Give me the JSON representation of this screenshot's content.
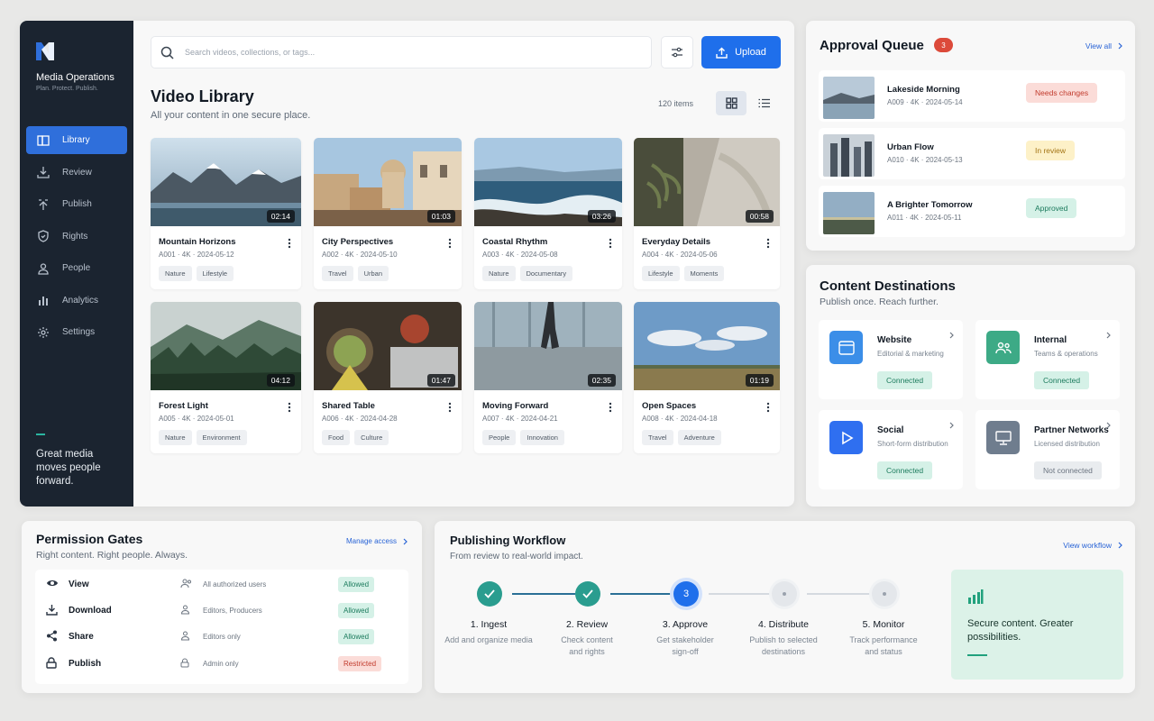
{
  "sidebar": {
    "brand": "Media Operations",
    "tagline": "Plan. Protect. Publish.",
    "nav": [
      {
        "label": "Library",
        "icon": "library-icon"
      },
      {
        "label": "Review",
        "icon": "download-icon"
      },
      {
        "label": "Publish",
        "icon": "upload-icon"
      },
      {
        "label": "Rights",
        "icon": "shield-icon"
      },
      {
        "label": "People",
        "icon": "person-icon"
      },
      {
        "label": "Analytics",
        "icon": "bar-chart-icon"
      },
      {
        "label": "Settings",
        "icon": "gear-icon"
      }
    ],
    "quote": "Great media moves people forward."
  },
  "search": {
    "placeholder": "Search videos, collections, or tags..."
  },
  "upload_label": "Upload",
  "library": {
    "title": "Video Library",
    "subtitle": "All your content in one secure place.",
    "count": "120 items",
    "videos": [
      {
        "title": "Mountain Horizons",
        "meta": "A001 · 4K · 2024-05-12",
        "duration": "02:14",
        "tags": [
          "Nature",
          "Lifestyle"
        ]
      },
      {
        "title": "City Perspectives",
        "meta": "A002 · 4K · 2024-05-10",
        "duration": "01:03",
        "tags": [
          "Travel",
          "Urban"
        ]
      },
      {
        "title": "Coastal Rhythm",
        "meta": "A003 · 4K · 2024-05-08",
        "duration": "03:26",
        "tags": [
          "Nature",
          "Documentary"
        ]
      },
      {
        "title": "Everyday Details",
        "meta": "A004 · 4K · 2024-05-06",
        "duration": "00:58",
        "tags": [
          "Lifestyle",
          "Moments"
        ]
      },
      {
        "title": "Forest Light",
        "meta": "A005 · 4K · 2024-05-01",
        "duration": "04:12",
        "tags": [
          "Nature",
          "Environment"
        ]
      },
      {
        "title": "Shared Table",
        "meta": "A006 · 4K · 2024-04-28",
        "duration": "01:47",
        "tags": [
          "Food",
          "Culture"
        ]
      },
      {
        "title": "Moving Forward",
        "meta": "A007 · 4K · 2024-04-21",
        "duration": "02:35",
        "tags": [
          "People",
          "Innovation"
        ]
      },
      {
        "title": "Open Spaces",
        "meta": "A008 · 4K · 2024-04-18",
        "duration": "01:19",
        "tags": [
          "Travel",
          "Adventure"
        ]
      }
    ]
  },
  "approval": {
    "title": "Approval Queue",
    "count": "3",
    "view_all": "View all",
    "items": [
      {
        "title": "Lakeside Morning",
        "meta": "A009 · 4K · 2024-05-14",
        "status": "Needs changes",
        "status_color": "#c13a2c"
      },
      {
        "title": "Urban Flow",
        "meta": "A010 · 4K · 2024-05-13",
        "status": "In review",
        "status_color": "#a37414"
      },
      {
        "title": "A Brighter Tomorrow",
        "meta": "A011 · 4K · 2024-05-11",
        "status": "Approved",
        "status_color": "#1c7b5d"
      }
    ]
  },
  "destinations": {
    "title": "Content Destinations",
    "subtitle": "Publish once. Reach further.",
    "items": [
      {
        "name": "Website",
        "desc": "Editorial & marketing",
        "status": "Connected",
        "icon": "browser-icon",
        "color": "#3b8ee8"
      },
      {
        "name": "Internal",
        "desc": "Teams & operations",
        "status": "Connected",
        "icon": "team-icon",
        "color": "#3daa86"
      },
      {
        "name": "Social",
        "desc": "Short-form distribution",
        "status": "Connected",
        "icon": "play-icon",
        "color": "#2f6ff0"
      },
      {
        "name": "Partner Networks",
        "desc": "Licensed distribution",
        "status": "Not connected",
        "icon": "monitor-icon",
        "color": "#6f7d8e"
      }
    ]
  },
  "permissions": {
    "title": "Permission Gates",
    "subtitle": "Right content. Right people. Always.",
    "manage": "Manage access",
    "rows": [
      {
        "action": "View",
        "who": "All authorized users",
        "status": "Allowed"
      },
      {
        "action": "Download",
        "who": "Editors, Producers",
        "status": "Allowed"
      },
      {
        "action": "Share",
        "who": "Editors only",
        "status": "Allowed"
      },
      {
        "action": "Publish",
        "who": "Admin only",
        "status": "Restricted"
      }
    ]
  },
  "workflow": {
    "title": "Publishing Workflow",
    "subtitle": "From review to real-world impact.",
    "view": "View workflow",
    "steps": [
      {
        "label": "1. Ingest",
        "desc": "Add and organize media",
        "state": "done"
      },
      {
        "label": "2. Review",
        "desc": "Check content and rights",
        "state": "done"
      },
      {
        "label": "3. Approve",
        "desc": "Get stakeholder sign-off",
        "state": "current",
        "number": "3"
      },
      {
        "label": "4. Distribute",
        "desc": "Publish to selected destinations",
        "state": "pending"
      },
      {
        "label": "5. Monitor",
        "desc": "Track performance and status",
        "state": "pending"
      }
    ],
    "promo": "Secure content. Greater possibilities."
  },
  "colors": {
    "accent": "#1f6feb",
    "sidebar": "#1b2430",
    "success": "#2a9d8f"
  }
}
